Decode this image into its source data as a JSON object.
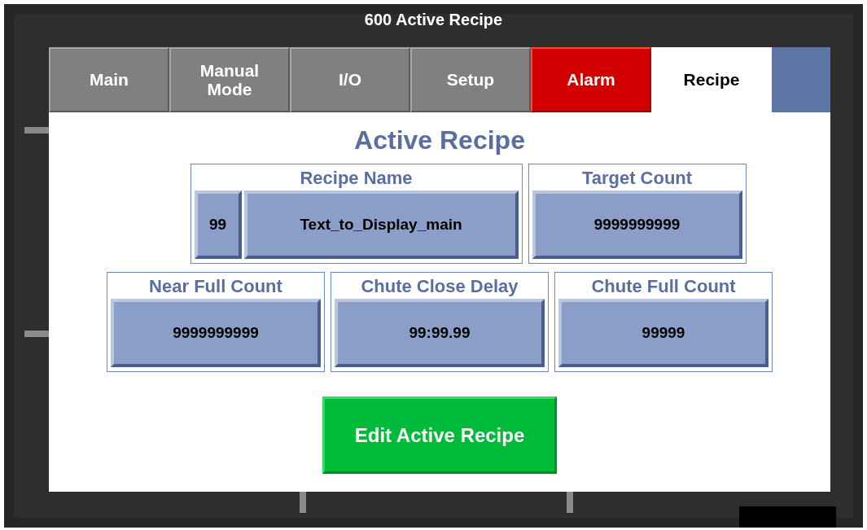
{
  "window": {
    "title": "600 Active Recipe"
  },
  "tabs": [
    {
      "label": "Main",
      "selected": false,
      "alert": false
    },
    {
      "label": "Manual Mode",
      "selected": false,
      "alert": false
    },
    {
      "label": "I/O",
      "selected": false,
      "alert": false
    },
    {
      "label": "Setup",
      "selected": false,
      "alert": false
    },
    {
      "label": "Alarm",
      "selected": false,
      "alert": true
    },
    {
      "label": "Recipe",
      "selected": true,
      "alert": false
    }
  ],
  "heading": "Active Recipe",
  "rows": [
    [
      {
        "label": "Recipe Name",
        "fields": [
          {
            "kind": "index",
            "value": "99"
          },
          {
            "kind": "text",
            "value": "Text_to_Display_main"
          }
        ]
      },
      {
        "label": "Target Count",
        "fields": [
          {
            "kind": "text",
            "value": "9999999999"
          }
        ]
      }
    ],
    [
      {
        "label": "Near Full Count",
        "fields": [
          {
            "kind": "text",
            "value": "9999999999"
          }
        ]
      },
      {
        "label": "Chute Close Delay",
        "fields": [
          {
            "kind": "text",
            "value": "99:99.99"
          }
        ]
      },
      {
        "label": "Chute Full Count",
        "fields": [
          {
            "kind": "text",
            "value": "99999"
          }
        ]
      }
    ]
  ],
  "action_button": "Edit Active Recipe"
}
